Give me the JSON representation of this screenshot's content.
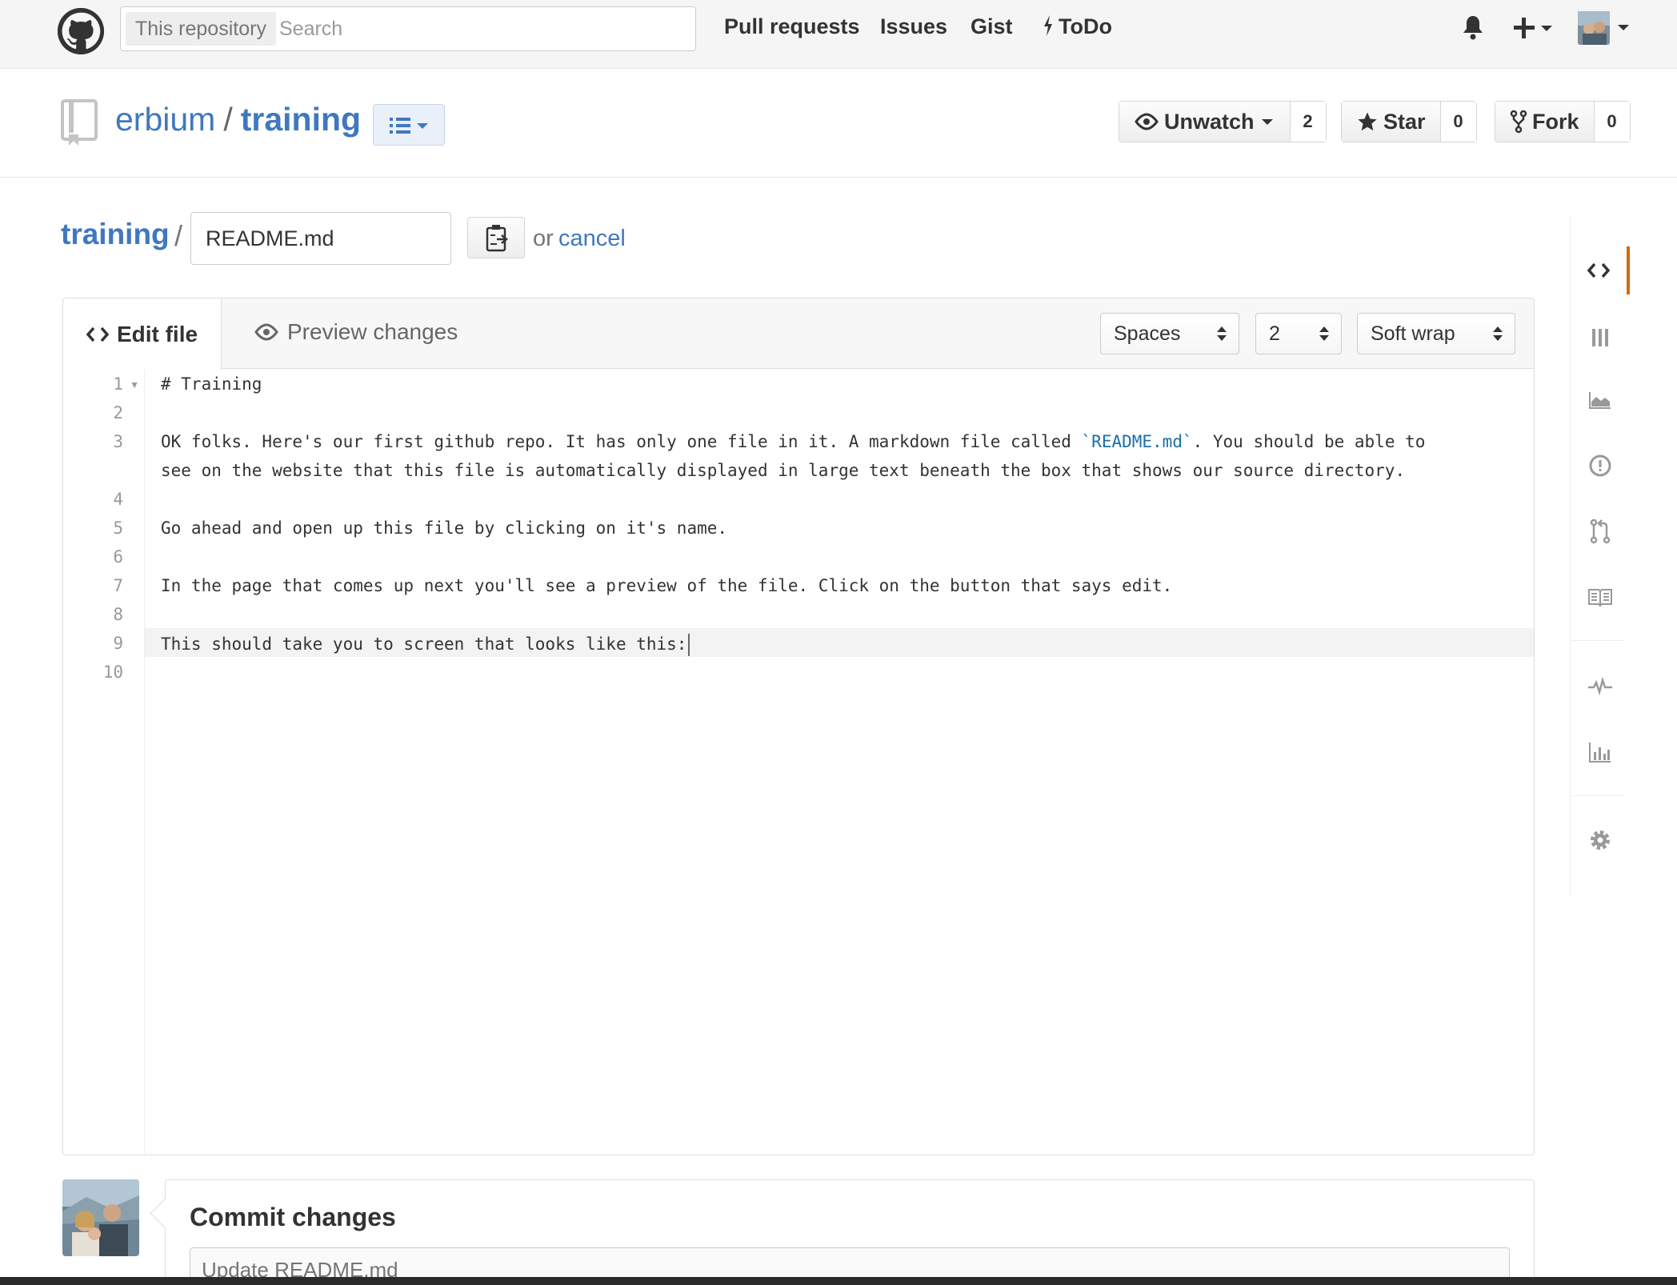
{
  "header": {
    "search_scope": "This repository",
    "search_placeholder": "Search",
    "nav": [
      "Pull requests",
      "Issues",
      "Gist",
      "ToDo"
    ]
  },
  "repo": {
    "owner": "erbium",
    "separator": "/",
    "name": "training",
    "watch_label": "Unwatch",
    "watch_count": "2",
    "star_label": "Star",
    "star_count": "0",
    "fork_label": "Fork",
    "fork_count": "0"
  },
  "file_path": {
    "root": "training",
    "separator": "/",
    "filename": "README.md",
    "or_text": "or",
    "cancel_label": "cancel"
  },
  "editor": {
    "tab_edit": "Edit file",
    "tab_preview": "Preview changes",
    "indent_mode": "Spaces",
    "indent_size": "2",
    "wrap_mode": "Soft wrap",
    "line_numbers": [
      "1",
      "2",
      "3",
      "4",
      "5",
      "6",
      "7",
      "8",
      "9",
      "10"
    ],
    "lines": {
      "l1": "# Training",
      "l3a_pre": "OK folks. Here's our first github repo. It has only one file in it. A markdown file called ",
      "l3a_code": "`README.md`",
      "l3a_post": ". You should be able to",
      "l3b": "see on the website that this file is automatically displayed in large text beneath the box that shows our source directory.",
      "l5": "Go ahead and open up this file by clicking on it's name.",
      "l7": "In the page that comes up next you'll see a preview of the file. Click on the button that says edit.",
      "l9": "This should take you to screen that looks like this:"
    }
  },
  "commit": {
    "title": "Commit changes",
    "placeholder": "Update README.md"
  },
  "colors": {
    "link": "#4078c0",
    "active_sidebar": "#d26911"
  }
}
